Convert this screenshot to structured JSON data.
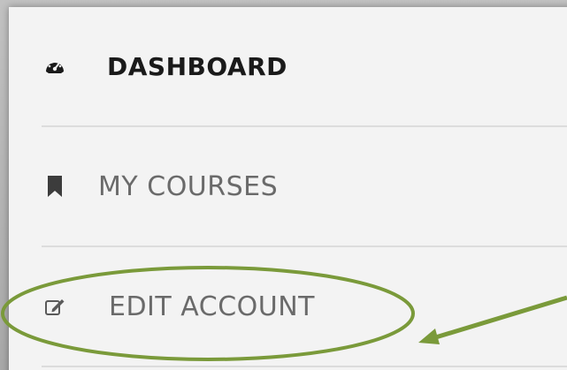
{
  "menu": {
    "items": [
      {
        "label": "DASHBOARD",
        "icon": "dashboard-gauge-icon"
      },
      {
        "label": "MY COURSES",
        "icon": "bookmark-icon"
      },
      {
        "label": "EDIT ACCOUNT",
        "icon": "edit-square-icon"
      }
    ]
  },
  "annotation": {
    "color": "#7a9a3a",
    "shapes": [
      "ellipse",
      "arrow"
    ]
  }
}
